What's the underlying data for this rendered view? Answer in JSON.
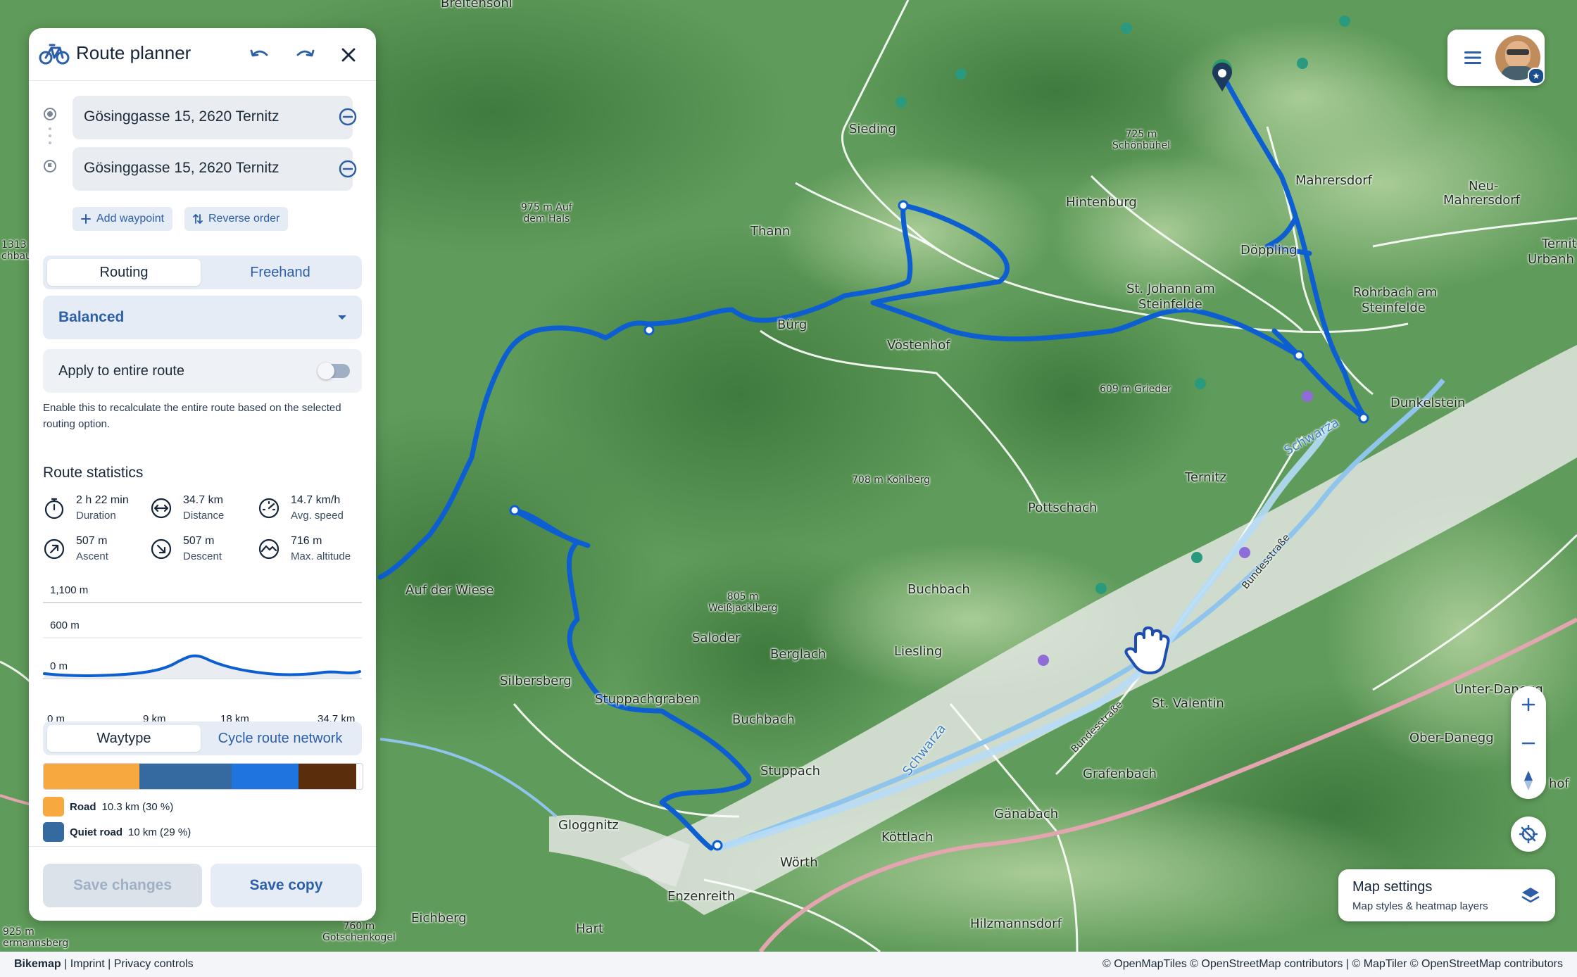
{
  "panel": {
    "title": "Route planner",
    "icons": {
      "app": "bicycle-icon",
      "undo": "undo-icon",
      "redo": "redo-icon",
      "close": "close-icon"
    },
    "waypoints": [
      {
        "value": "Gösinggasse 15, 2620 Ternitz",
        "icon": "start-circle-icon",
        "remove_icon": "minus-circle-icon"
      },
      {
        "value": "Gösinggasse 15, 2620 Ternitz",
        "icon": "flag-icon",
        "remove_icon": "minus-circle-icon"
      }
    ],
    "add_waypoint": "Add waypoint",
    "reverse_order": "Reverse order",
    "mode_tabs": [
      "Routing",
      "Freehand"
    ],
    "routing_option": "Balanced",
    "apply_label": "Apply to entire route",
    "apply_enabled": false,
    "hint": "Enable this to recalculate the entire route based on the selected routing option.",
    "stats_title": "Route statistics",
    "stats": [
      {
        "value": "2 h 22 min",
        "label": "Duration",
        "icon": "stopwatch-icon"
      },
      {
        "value": "34.7 km",
        "label": "Distance",
        "icon": "distance-icon"
      },
      {
        "value": "14.7 km/h",
        "label": "Avg. speed",
        "icon": "speedometer-icon"
      },
      {
        "value": "507 m",
        "label": "Ascent",
        "icon": "ascent-icon"
      },
      {
        "value": "507 m",
        "label": "Descent",
        "icon": "descent-icon"
      },
      {
        "value": "716 m",
        "label": "Max. altitude",
        "icon": "altitude-icon"
      }
    ],
    "elevation": {
      "y_labels": [
        "1,100 m",
        "600 m",
        "0 m"
      ],
      "x_labels": [
        "0 m",
        "9 km",
        "18 km",
        "34.7 km"
      ]
    },
    "waytype_tabs": [
      "Waytype",
      "Cycle route network"
    ],
    "waytype_segments": [
      {
        "color": "#f7a940",
        "share": 0.3
      },
      {
        "color": "#356aa0",
        "share": 0.29
      },
      {
        "color": "#1f75dd",
        "share": 0.21
      },
      {
        "color": "#5a2e0c",
        "share": 0.18
      }
    ],
    "legend": [
      {
        "name": "Road",
        "detail": "10.3 km (30 %)",
        "color": "#f7a940"
      },
      {
        "name": "Quiet road",
        "detail": "10 km (29 %)",
        "color": "#356aa0"
      }
    ],
    "save_changes": "Save changes",
    "save_copy": "Save copy"
  },
  "map": {
    "places": [
      {
        "name": "Sieding"
      },
      {
        "name": "Thann"
      },
      {
        "name": "Bürg"
      },
      {
        "name": "Vöstenhof"
      },
      {
        "name": "Hintenburg"
      },
      {
        "name": "Mahrersdorf"
      },
      {
        "name": "Neu-"
      },
      {
        "name": "Mahrersdorf"
      },
      {
        "name": "Döppling"
      },
      {
        "name": "St. Johann am"
      },
      {
        "name": "Steinfelde"
      },
      {
        "name": "Rohrbach am"
      },
      {
        "name": "Steinfelde"
      },
      {
        "name": "Ternitz"
      },
      {
        "name": "Urbanh"
      },
      {
        "name": "Dunkelstein"
      },
      {
        "name": "Ternitz"
      },
      {
        "name": "Pottschach"
      },
      {
        "name": "Auf der Wiese"
      },
      {
        "name": "Buchbach"
      },
      {
        "name": "Saloder"
      },
      {
        "name": "Berglach"
      },
      {
        "name": "Liesling"
      },
      {
        "name": "Silbersberg"
      },
      {
        "name": "Stuppachgraben"
      },
      {
        "name": "Buchbach"
      },
      {
        "name": "St. Valentin"
      },
      {
        "name": "Unter-Danegg"
      },
      {
        "name": "Ober-Danegg"
      },
      {
        "name": "Stuppach"
      },
      {
        "name": "Grafenbach"
      },
      {
        "name": "Gloggnitz"
      },
      {
        "name": "Köttlach"
      },
      {
        "name": "Gänabach"
      },
      {
        "name": "Wörth"
      },
      {
        "name": "Enzenreith"
      },
      {
        "name": "Eichberg"
      },
      {
        "name": "Hart"
      },
      {
        "name": "Hilzmannsdorf"
      },
      {
        "name": "hof"
      },
      {
        "name": "Breitensohl"
      }
    ],
    "peaks": [
      {
        "name": "725 m\nSchönbühel"
      },
      {
        "name": "975 m Auf\ndem Hals"
      },
      {
        "name": "609 m Grieder"
      },
      {
        "name": "708 m Kohlberg"
      },
      {
        "name": "805 m\nWeißjacklberg"
      },
      {
        "name": "760 m\nGotschenkogel"
      },
      {
        "name": "925 m\nermannsberg"
      },
      {
        "name": "1313\nchbaur"
      }
    ],
    "rivers": [
      "Schwarza",
      "Schwarza"
    ],
    "roads": [
      "Bundesstraße",
      "Bundesstraße"
    ],
    "menu_icon": "hamburger-menu-icon",
    "avatar": "user-avatar",
    "zoom_in_icon": "plus-icon",
    "zoom_out_icon": "minus-icon",
    "compass_icon": "compass-icon",
    "locate_icon": "locate-off-icon",
    "settings_title": "Map settings",
    "settings_sub": "Map styles & heatmap layers",
    "layers_icon": "layers-icon",
    "drag_cursor_icon": "hand-cursor-icon"
  },
  "footer": {
    "brand": "Bikemap",
    "links": [
      "Imprint",
      "Privacy controls"
    ],
    "attribution": "© OpenMapTiles © OpenStreetMap contributors | © MapTiler © OpenStreetMap contributors"
  }
}
